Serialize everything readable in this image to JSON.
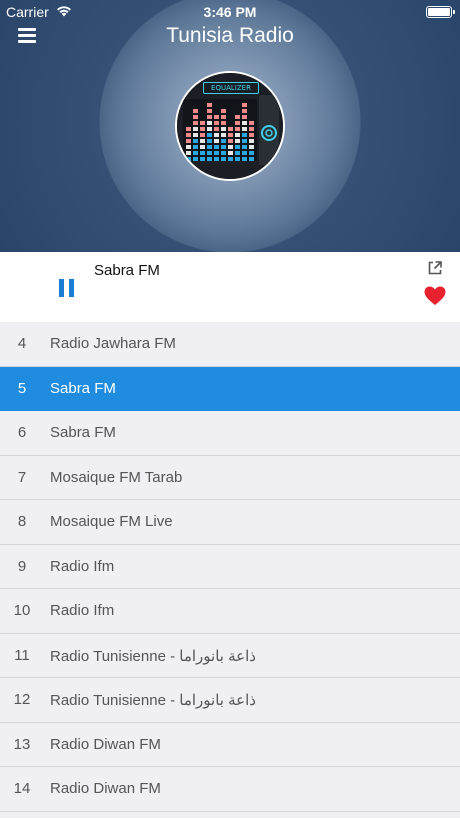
{
  "status_bar": {
    "carrier": "Carrier",
    "time": "3:46 PM"
  },
  "header": {
    "title": "Tunisia Radio",
    "logo_text": "EQUALIZER",
    "menu_icon": "hamburger-menu-icon"
  },
  "player": {
    "now_playing": "Sabra FM",
    "state": "playing",
    "icons": [
      "pause-icon",
      "share-icon",
      "heart-icon"
    ],
    "accent_color": "#1a7fd4",
    "heart_color": "#e8212e"
  },
  "stations": [
    {
      "number": "4",
      "name": "Radio Jawhara FM"
    },
    {
      "number": "5",
      "name": "Sabra FM",
      "selected": true
    },
    {
      "number": "6",
      "name": "Sabra FM"
    },
    {
      "number": "7",
      "name": "Mosaique FM Tarab"
    },
    {
      "number": "8",
      "name": "Mosaique FM Live"
    },
    {
      "number": "9",
      "name": "Radio Ifm"
    },
    {
      "number": "10",
      "name": "Radio Ifm"
    },
    {
      "number": "11",
      "name": "Radio Tunisienne - ذاعة بانوراما"
    },
    {
      "number": "12",
      "name": "Radio Tunisienne - ذاعة بانوراما"
    },
    {
      "number": "13",
      "name": "Radio Diwan FM"
    },
    {
      "number": "14",
      "name": "Radio Diwan FM"
    }
  ],
  "colors": {
    "selected_row": "#1f8ce0",
    "list_background": "#efeff4"
  }
}
